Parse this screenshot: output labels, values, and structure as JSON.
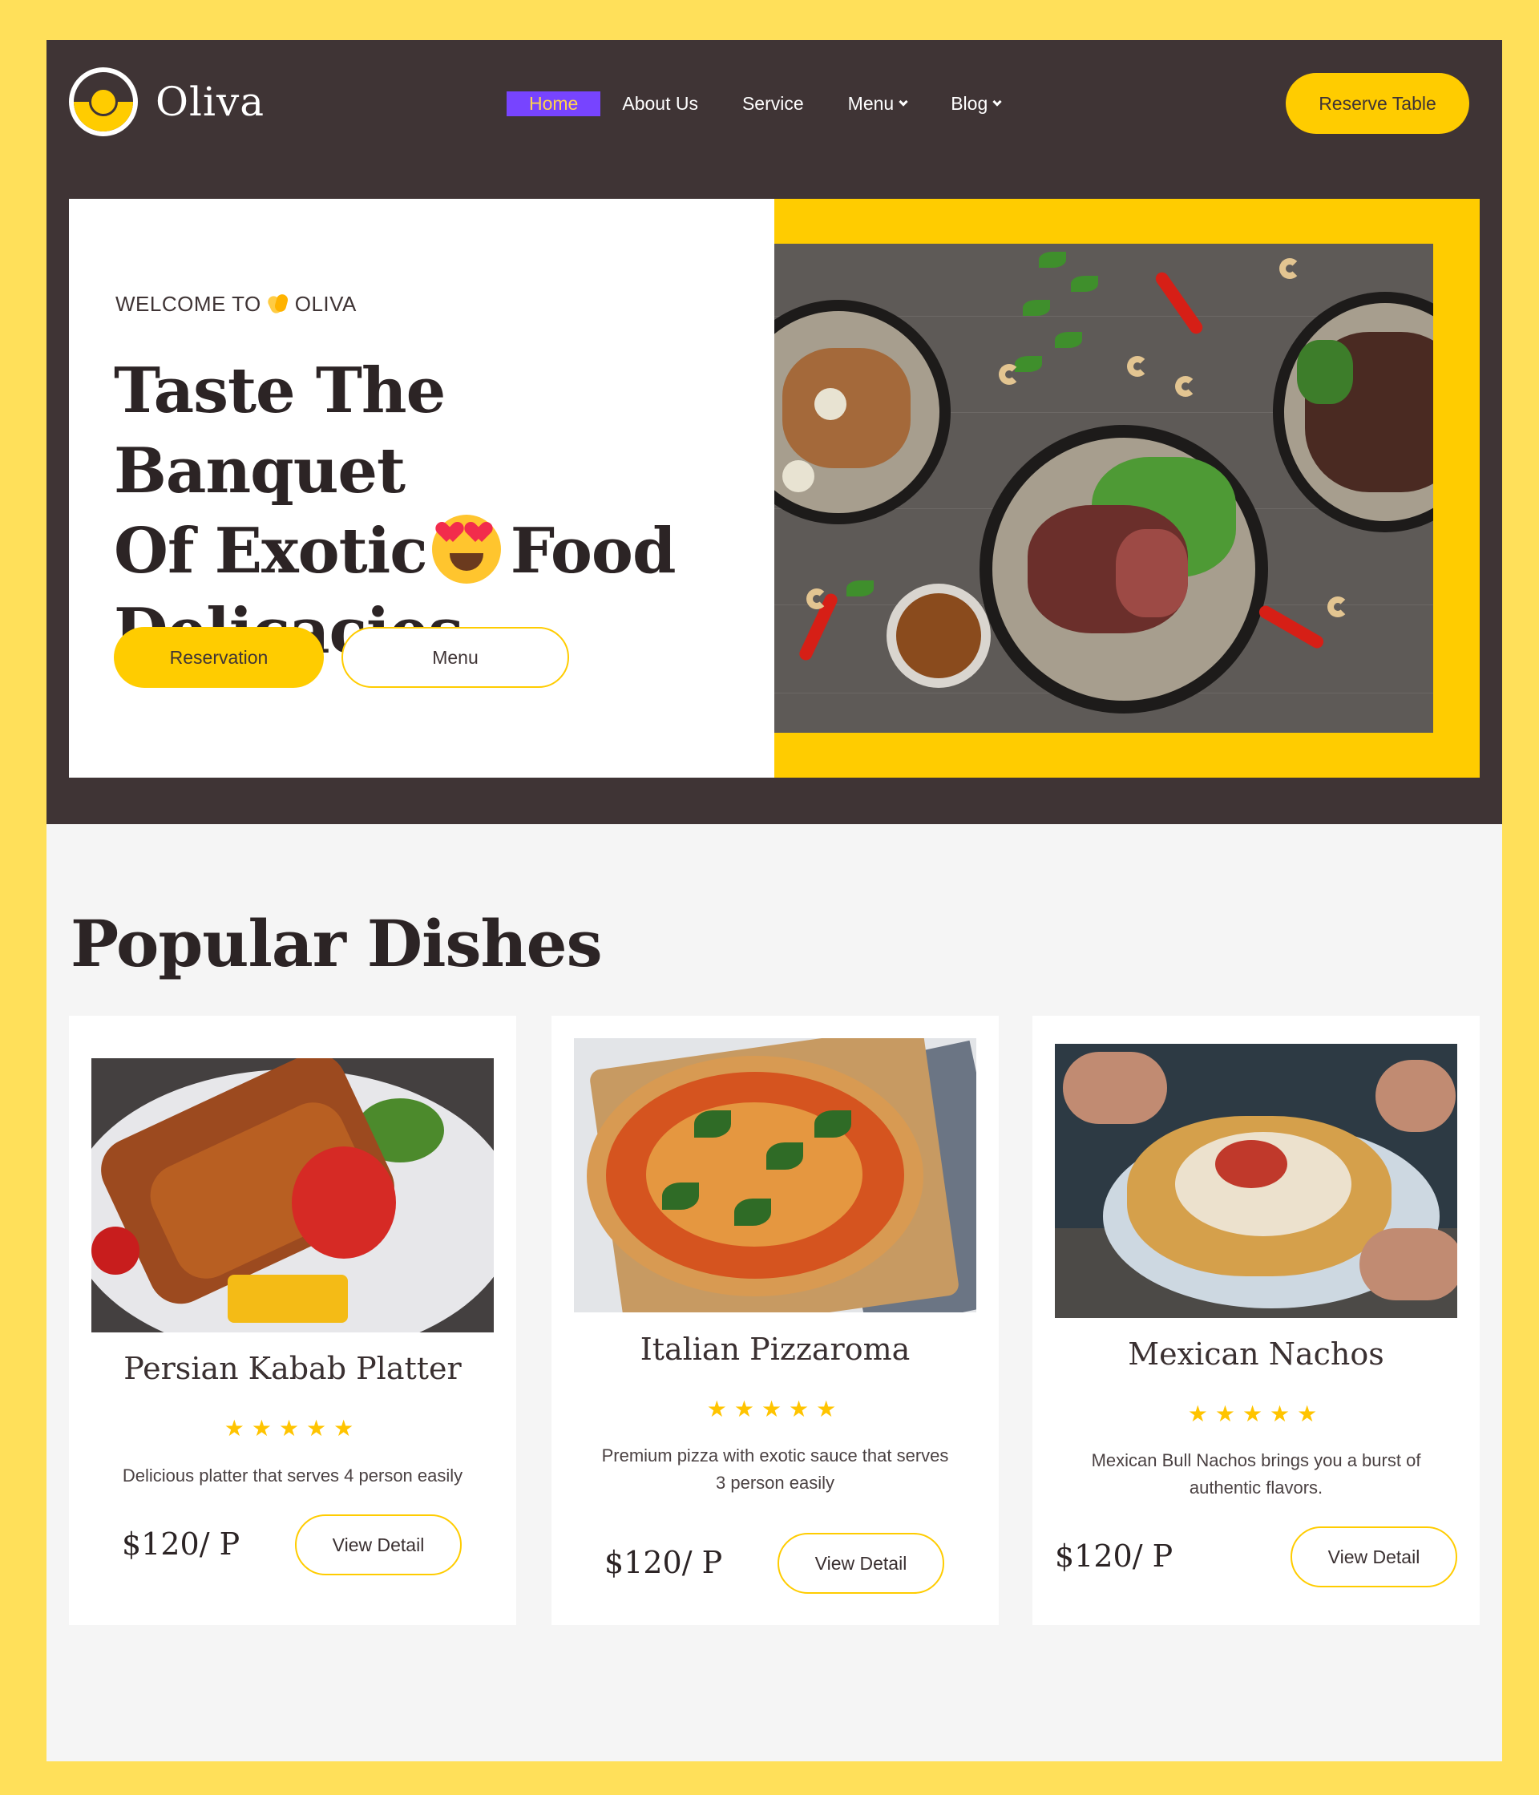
{
  "brand": {
    "name": "Oliva"
  },
  "nav": {
    "items": [
      {
        "label": "Home",
        "active": true,
        "dropdown": false
      },
      {
        "label": "About Us",
        "active": false,
        "dropdown": false
      },
      {
        "label": "Service",
        "active": false,
        "dropdown": false
      },
      {
        "label": "Menu",
        "active": false,
        "dropdown": true
      },
      {
        "label": "Blog",
        "active": false,
        "dropdown": true
      }
    ],
    "cta_label": "Reserve Table"
  },
  "hero": {
    "welcome_prefix": "WELCOME TO",
    "welcome_icon": "clapping-hands-icon",
    "welcome_brand": "OLIVA",
    "title_line1": "Taste The Banquet",
    "title_line2_a": "Of Exotic",
    "title_emoji": "heart-eyes-emoji",
    "title_line2_b": "Food",
    "title_line3": "Delicacies",
    "primary_button": "Reservation",
    "secondary_button": "Menu"
  },
  "popular": {
    "title": "Popular Dishes",
    "dishes": [
      {
        "name": "Persian Kabab Platter",
        "stars": "★★★★★",
        "rating": 5,
        "description": "Delicious platter that serves 4 person easily",
        "price": "$120/ P",
        "button": "View Detail"
      },
      {
        "name": "Italian Pizzaroma",
        "stars": "★★★★★",
        "rating": 5,
        "description": "Premium pizza with exotic sauce that serves 3 person easily",
        "price": "$120/ P",
        "button": "View Detail"
      },
      {
        "name": "Mexican Nachos",
        "stars": "★★★★★",
        "rating": 5,
        "description": "Mexican Bull Nachos brings you a burst of authentic flavors.",
        "price": "$120/ P",
        "button": "View Detail"
      }
    ]
  },
  "colors": {
    "page_background": "#ffe05a",
    "header_dark": "#3f3435",
    "accent_yellow": "#ffcc00",
    "active_nav": "#7744ff",
    "content_background": "#f5f5f5"
  }
}
